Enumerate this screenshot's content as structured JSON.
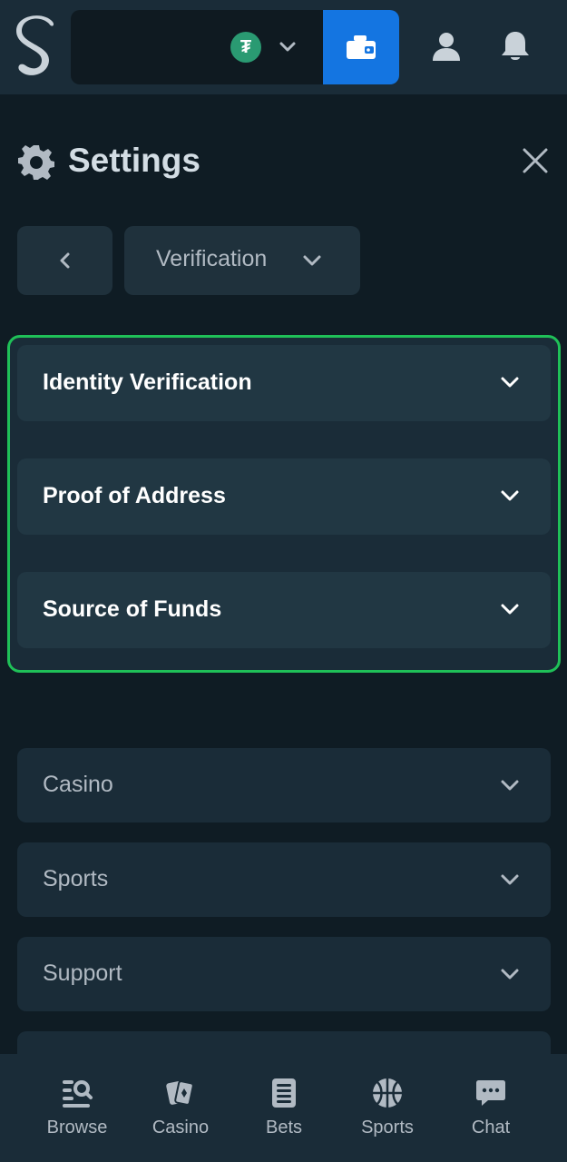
{
  "header": {
    "logo_icon": "stake-s-logo-icon",
    "currency_icon": "tether-usdt-icon",
    "currency_symbol": "₮",
    "wallet_icon": "wallet-icon",
    "profile_icon": "user-icon",
    "notifications_icon": "bell-icon"
  },
  "settings": {
    "title": "Settings",
    "section_dropdown": {
      "selected": "Verification"
    }
  },
  "verification": {
    "items": [
      {
        "label": "Identity Verification"
      },
      {
        "label": "Proof of Address"
      },
      {
        "label": "Source of Funds"
      }
    ]
  },
  "menu": {
    "items": [
      {
        "label": "Casino"
      },
      {
        "label": "Sports"
      },
      {
        "label": "Support"
      }
    ]
  },
  "bottom_nav": {
    "items": [
      {
        "label": "Browse",
        "icon": "browse-icon"
      },
      {
        "label": "Casino",
        "icon": "casino-cards-icon"
      },
      {
        "label": "Bets",
        "icon": "bets-icon"
      },
      {
        "label": "Sports",
        "icon": "basketball-icon"
      },
      {
        "label": "Chat",
        "icon": "chat-icon"
      }
    ]
  },
  "colors": {
    "background": "#0f1c24",
    "panel": "#1a2c38",
    "item": "#213743",
    "accent_blue": "#1475e1",
    "highlight_green": "#1fc058",
    "tether_green": "#2a9a72",
    "muted_text": "#b1bac3"
  }
}
